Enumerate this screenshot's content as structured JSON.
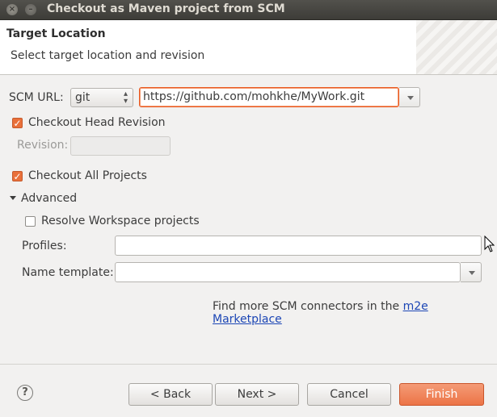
{
  "window": {
    "title": "Checkout as Maven project from SCM",
    "close_glyph": "×",
    "minimize_glyph": "–"
  },
  "header": {
    "title": "Target Location",
    "description": "Select target location and revision"
  },
  "scm": {
    "label": "SCM URL:",
    "type_value": "git",
    "url_value": "https://github.com/mohkhe/MyWork.git"
  },
  "head_revision": {
    "label": "Checkout Head Revision",
    "checked": true
  },
  "revision": {
    "label": "Revision:",
    "value": ""
  },
  "all_projects": {
    "label": "Checkout All Projects",
    "checked": true
  },
  "advanced": {
    "label": "Advanced",
    "expanded": true,
    "resolve_workspace": {
      "label": "Resolve Workspace projects",
      "checked": false
    },
    "profiles": {
      "label": "Profiles:",
      "value": ""
    },
    "name_template": {
      "label": "Name template:",
      "value": ""
    }
  },
  "marketplace": {
    "text": "Find more SCM connectors in the ",
    "link": "m2e Marketplace"
  },
  "buttons": {
    "back": "< Back",
    "next": "Next >",
    "cancel": "Cancel",
    "finish": "Finish",
    "help": "?"
  },
  "colors": {
    "accent": "#e9703a",
    "link": "#1c46b5"
  }
}
